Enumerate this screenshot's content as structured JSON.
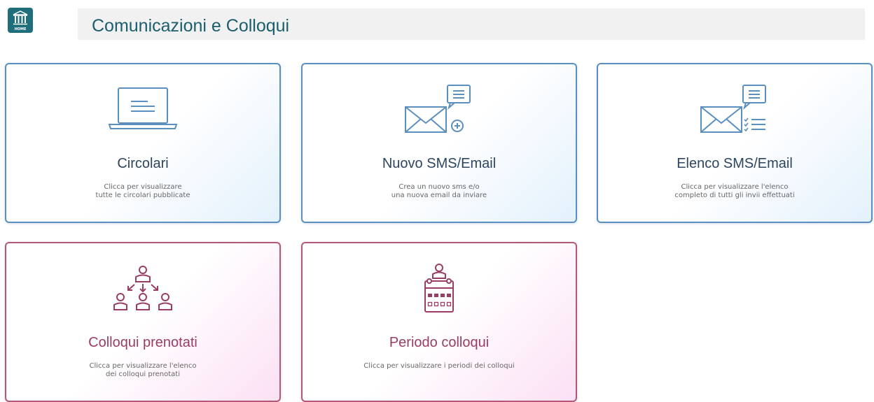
{
  "header": {
    "home_label": "HOME",
    "title": "Comunicazioni e Colloqui"
  },
  "cards": [
    {
      "title": "Circolari",
      "description": "Clicca per visualizzare\ntutte le circolari pubblicate",
      "icon": "laptop-icon",
      "theme": "blue"
    },
    {
      "title": "Nuovo SMS/Email",
      "description": "Crea un nuovo sms e/o\nuna nuova email da inviare",
      "icon": "envelope-plus-icon",
      "theme": "blue"
    },
    {
      "title": "Elenco SMS/Email",
      "description": "Clicca per visualizzare l'elenco\ncompleto di tutti gli invii effettuati",
      "icon": "envelope-list-icon",
      "theme": "blue"
    },
    {
      "title": "Colloqui prenotati",
      "description": "Clicca per visualizzare l'elenco\ndei colloqui prenotati",
      "icon": "people-hierarchy-icon",
      "theme": "pink"
    },
    {
      "title": "Periodo colloqui",
      "description": "Clicca per visualizzare i periodi dei colloqui",
      "icon": "person-calendar-icon",
      "theme": "pink"
    }
  ],
  "colors": {
    "blue_accent": "#5b8fc0",
    "pink_accent": "#b35978",
    "header_teal": "#1f6e7c"
  }
}
